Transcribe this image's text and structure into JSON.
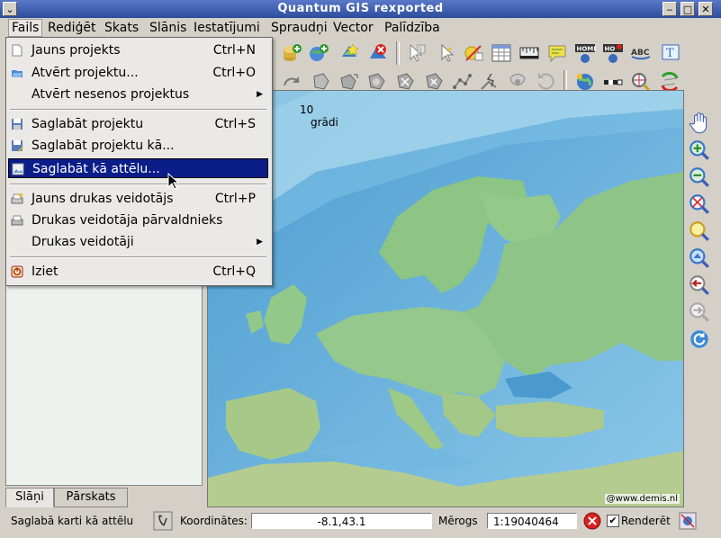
{
  "window": {
    "title": "Quantum GIS rexported"
  },
  "menubar": {
    "items": [
      "Fails",
      "Rediģēt",
      "Skats",
      "Slānis",
      "Iestatījumi",
      "Spraudņi",
      "Vector",
      "Palīdzība"
    ]
  },
  "file_menu": {
    "items": [
      {
        "label": "Jauns projekts",
        "shortcut": "Ctrl+N"
      },
      {
        "label": "Atvērt projektu...",
        "shortcut": "Ctrl+O"
      },
      {
        "label": "Atvērt nesenos projektus",
        "shortcut": ""
      },
      {
        "label": "Saglabāt projektu",
        "shortcut": "Ctrl+S"
      },
      {
        "label": "Saglabāt projektu kā...",
        "shortcut": ""
      },
      {
        "label": "Saglabāt kā attēlu...",
        "shortcut": ""
      },
      {
        "label": "Jauns drukas veidotājs",
        "shortcut": "Ctrl+P"
      },
      {
        "label": "Drukas veidotāja pārvaldnieks",
        "shortcut": ""
      },
      {
        "label": "Drukas veidotāji",
        "shortcut": ""
      },
      {
        "label": "Iziet",
        "shortcut": "Ctrl+Q"
      }
    ],
    "highlighted": "Saglabāt kā attēlu..."
  },
  "toolbar_labels": {
    "home": "HOME",
    "abc": "ABC"
  },
  "map": {
    "scale_value": "10",
    "scale_unit": "grādi",
    "credit": "@www.demis.nl"
  },
  "panel_tabs": [
    "Slāņi",
    "Pārskats"
  ],
  "status": {
    "message": "Saglabā karti kā attēlu",
    "coords_label": "Koordinātes:",
    "coords_value": "-8.1,43.1",
    "scale_label": "Mērogs",
    "scale_value": "1:19040464",
    "render_label": "Renderēt",
    "render_checked": true
  },
  "colors": {
    "title_bar": "#3a5cb4",
    "highlight": "#0a1d88",
    "sea": "#6fb3d8",
    "land": "#8fc58a"
  }
}
